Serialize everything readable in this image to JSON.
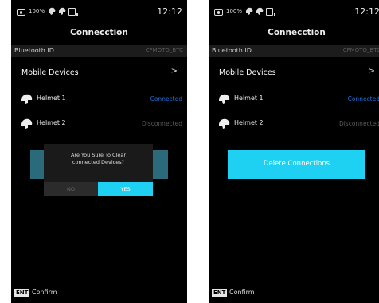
{
  "statusbar": {
    "battery": "100%",
    "time": "12:12"
  },
  "title": "Connecction",
  "bluetooth": {
    "label": "Bluetooth ID",
    "value": "CFMOTO_BTC"
  },
  "mobile_devices": {
    "label": "Mobile Devices",
    "chevron": ">"
  },
  "helmets": [
    {
      "name": "Helmet 1",
      "status": "Connected"
    },
    {
      "name": "Helmet 2",
      "status": "Disconnected"
    }
  ],
  "dialog": {
    "question_line1": "Are You Sure To Clear",
    "question_line2": "connected Devices?",
    "no": "NO",
    "yes": "YES"
  },
  "delete_button": "Delete Connections",
  "footer": {
    "key": "ENT",
    "label": "Confirm"
  },
  "colors": {
    "accent": "#1ed0f2",
    "connected": "#1f6fd6",
    "dialog_back": "#2a6a7a"
  },
  "icons": [
    "camera-icon",
    "helmet-icon",
    "sd-card-icon",
    "chevron-right-icon"
  ]
}
